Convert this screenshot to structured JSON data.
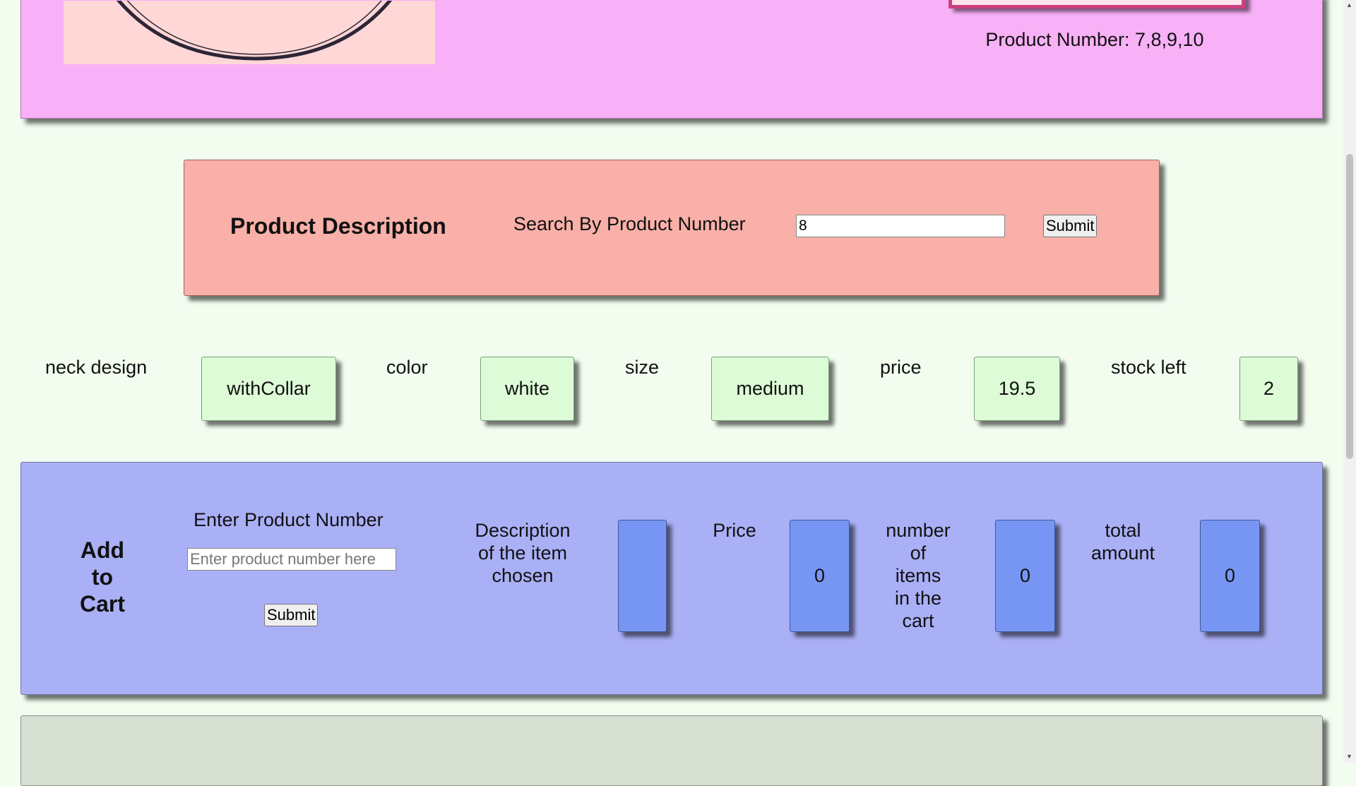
{
  "top_panel": {
    "product_numbers": "Product Number: 7,8,9,10"
  },
  "description": {
    "title": "Product Description",
    "search_label": "Search By Product Number",
    "search_value": "8",
    "submit_label": "Submit"
  },
  "attributes": [
    {
      "label": "neck design",
      "value": "withCollar"
    },
    {
      "label": "color",
      "value": "white"
    },
    {
      "label": "size",
      "value": "medium"
    },
    {
      "label": "price",
      "value": "19.5"
    },
    {
      "label": "stock left",
      "value": "2"
    }
  ],
  "cart": {
    "title_lines": [
      "Add",
      "to",
      "Cart"
    ],
    "enter_label": "Enter Product Number",
    "input_placeholder": "Enter product number here",
    "submit_label": "Submit",
    "description_label_lines": [
      "Description",
      "of the item",
      "chosen"
    ],
    "description_value": "",
    "price_label": "Price",
    "price_value": "0",
    "count_label_lines": [
      "number",
      "of",
      "items",
      "in the",
      "cart"
    ],
    "count_value": "0",
    "total_label_lines": [
      "total",
      "amount"
    ],
    "total_value": "0"
  },
  "colors": {
    "page_bg": "#f2fdf0",
    "top_panel": "#f8b0f6",
    "description_panel": "#f8b0a8",
    "attribute_box": "#dcfbd6",
    "cart_panel": "#aab0f6",
    "cart_box": "#7796f4",
    "bottom_panel": "#d7dfd2"
  }
}
